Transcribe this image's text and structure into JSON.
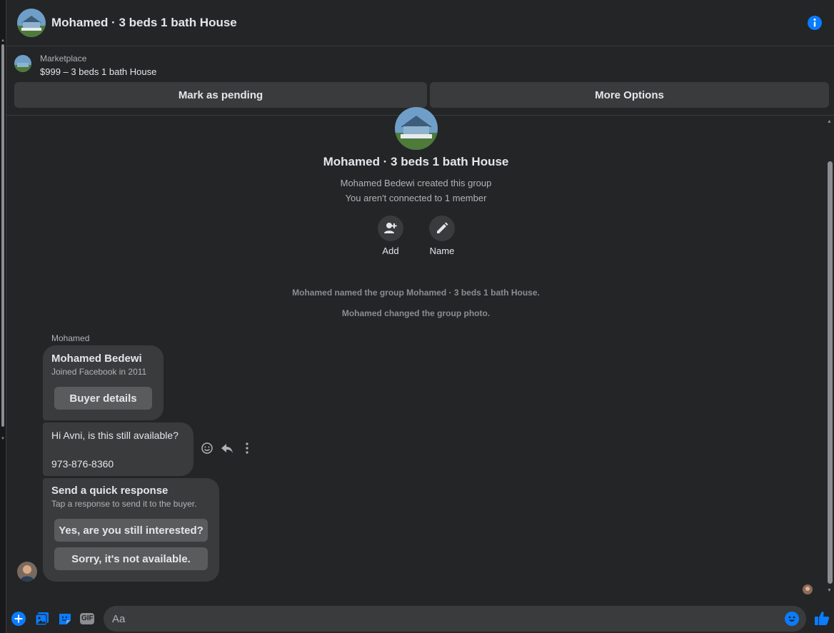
{
  "header": {
    "title": "Mohamed · 3 beds 1 bath House"
  },
  "marketplace": {
    "label": "Marketplace",
    "price_title": "$999 – 3 beds 1 bath House",
    "mark_pending_label": "Mark as pending",
    "more_options_label": "More Options"
  },
  "group_intro": {
    "title": "Mohamed · 3 beds 1 bath House",
    "created_by": "Mohamed Bedewi created this group",
    "connection_note": "You aren't connected to 1 member",
    "actions": [
      {
        "label": "Add",
        "icon": "add-person-icon"
      },
      {
        "label": "Name",
        "icon": "pencil-icon"
      }
    ]
  },
  "system_messages": [
    "Mohamed named the group Mohamed · 3 beds 1 bath House.",
    "Mohamed changed the group photo."
  ],
  "thread": {
    "sender_name": "Mohamed",
    "profile_card": {
      "name": "Mohamed Bedewi",
      "joined": "Joined Facebook in 2011",
      "button_label": "Buyer details"
    },
    "message": {
      "line1": "Hi Avni, is this still available?",
      "line2": "973-876-8360"
    },
    "quick_response": {
      "title": "Send a quick response",
      "subtitle": "Tap a response to send it to the buyer.",
      "options": [
        "Yes, are you still interested?",
        "Sorry, it's not available."
      ]
    }
  },
  "composer": {
    "placeholder": "Aa",
    "gif_label": "GIF"
  },
  "colors": {
    "background": "#242526",
    "bubble": "#3a3b3c",
    "accent": "#0a7cff"
  }
}
